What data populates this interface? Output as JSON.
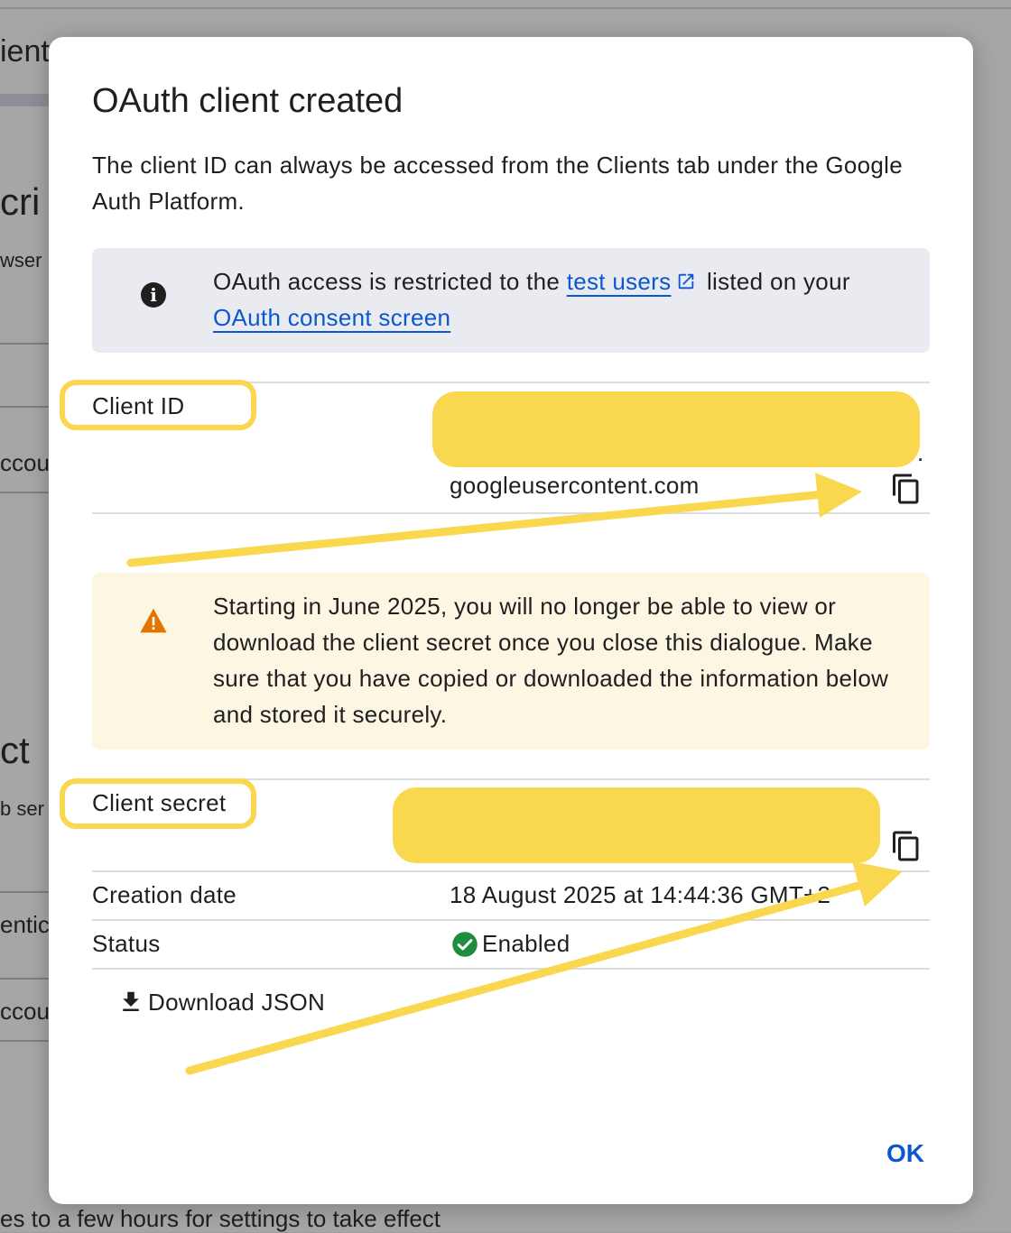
{
  "background": {
    "fragments": {
      "tab_title": "ient",
      "heading_1": "cri",
      "sub_1": "wser",
      "account_1": "ccou",
      "heading_2": "ct",
      "sub_2": "b ser",
      "auth_1": "entic",
      "account_2": "ccou"
    },
    "footer": "es to a few hours for settings to take effect"
  },
  "dialog": {
    "title": "OAuth client created",
    "description": "The client ID can always be accessed from the Clients tab under the Google Auth Platform.",
    "info": {
      "icon": "info-icon",
      "text_before": "OAuth access is restricted to the ",
      "link_test_users": "test users",
      "text_middle": " listed on your ",
      "link_consent": "OAuth consent screen"
    },
    "client_id": {
      "label": "Client ID",
      "value_suffix": "googleusercontent.com",
      "dot": "."
    },
    "warning": {
      "icon": "warning-icon",
      "text": "Starting in June 2025, you will no longer be able to view or download the client secret once you close this dialogue. Make sure that you have copied or downloaded the information below and stored it securely."
    },
    "client_secret": {
      "label": "Client secret"
    },
    "creation_date": {
      "label": "Creation date",
      "value": "18 August 2025 at 14:44:36 GMT+2"
    },
    "status": {
      "label": "Status",
      "value": "Enabled",
      "icon": "check-circle-icon"
    },
    "download_label": "Download JSON",
    "ok_label": "OK"
  },
  "colors": {
    "annotation_yellow": "#f9d84f",
    "link_blue": "#0b57d0",
    "warning_orange": "#e37400",
    "status_green": "#1e8e3e"
  }
}
